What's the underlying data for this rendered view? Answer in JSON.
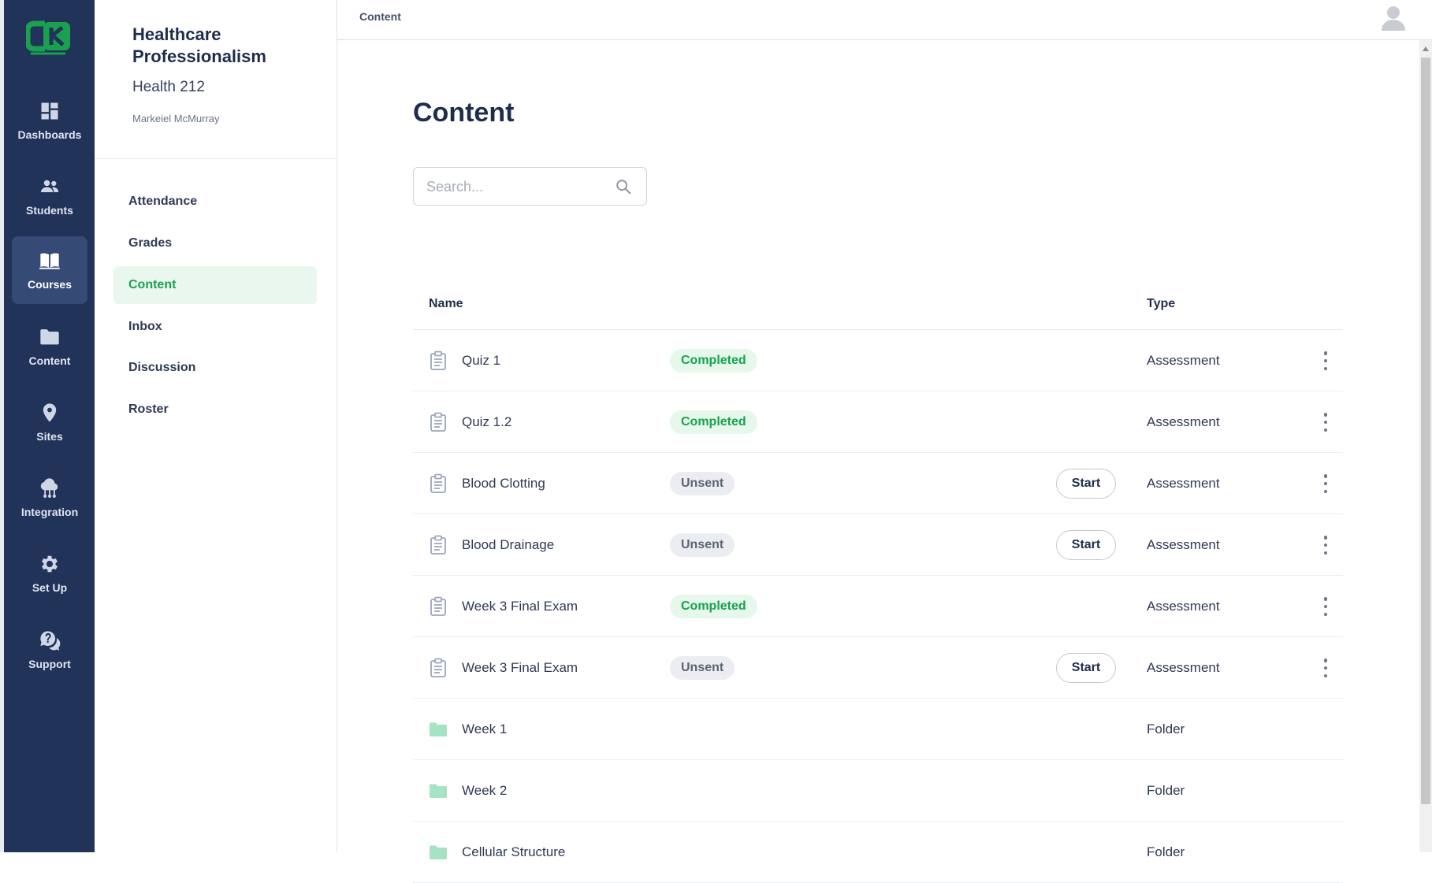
{
  "brand": {
    "logo_text": "CK",
    "logo_color": "#1aa150"
  },
  "colors": {
    "rail_bg": "#22335a",
    "accent_green": "#1aa150",
    "completed_bg": "#e6f7ec",
    "unsent_bg": "#ebedf0"
  },
  "rail": {
    "items": [
      {
        "label": "Dashboards",
        "icon": "dashboard-icon"
      },
      {
        "label": "Students",
        "icon": "students-icon"
      },
      {
        "label": "Courses",
        "icon": "book-icon",
        "active": true
      },
      {
        "label": "Content",
        "icon": "folder-icon"
      },
      {
        "label": "Sites",
        "icon": "location-pin-icon"
      },
      {
        "label": "Integration",
        "icon": "cloud-network-icon"
      },
      {
        "label": "Set Up",
        "icon": "gear-icon"
      },
      {
        "label": "Support",
        "icon": "chat-help-icon"
      }
    ]
  },
  "course": {
    "title": "Healthcare Professionalism",
    "code": "Health 212",
    "owner": "Markeiel McMurray",
    "menu": [
      {
        "label": "Attendance"
      },
      {
        "label": "Grades"
      },
      {
        "label": "Content",
        "active": true
      },
      {
        "label": "Inbox"
      },
      {
        "label": "Discussion"
      },
      {
        "label": "Roster"
      }
    ]
  },
  "topbar": {
    "breadcrumb": "Content",
    "avatar_icon": "user-avatar-icon"
  },
  "main": {
    "title": "Content",
    "search": {
      "placeholder": "Search...",
      "value": ""
    },
    "columns": {
      "name": "Name",
      "type": "Type"
    },
    "start_label": "Start",
    "rows": [
      {
        "name": "Quiz 1",
        "status": "Completed",
        "type": "Assessment",
        "kind": "assessment"
      },
      {
        "name": "Quiz 1.2",
        "status": "Completed",
        "type": "Assessment",
        "kind": "assessment"
      },
      {
        "name": "Blood Clotting",
        "status": "Unsent",
        "type": "Assessment",
        "kind": "assessment"
      },
      {
        "name": "Blood Drainage",
        "status": "Unsent",
        "type": "Assessment",
        "kind": "assessment"
      },
      {
        "name": "Week 3 Final Exam",
        "status": "Completed",
        "type": "Assessment",
        "kind": "assessment"
      },
      {
        "name": "Week 3 Final Exam",
        "status": "Unsent",
        "type": "Assessment",
        "kind": "assessment"
      },
      {
        "name": "Week 1",
        "status": "",
        "type": "Folder",
        "kind": "folder"
      },
      {
        "name": "Week 2",
        "status": "",
        "type": "Folder",
        "kind": "folder"
      },
      {
        "name": "Cellular Structure",
        "status": "",
        "type": "Folder",
        "kind": "folder"
      }
    ]
  }
}
